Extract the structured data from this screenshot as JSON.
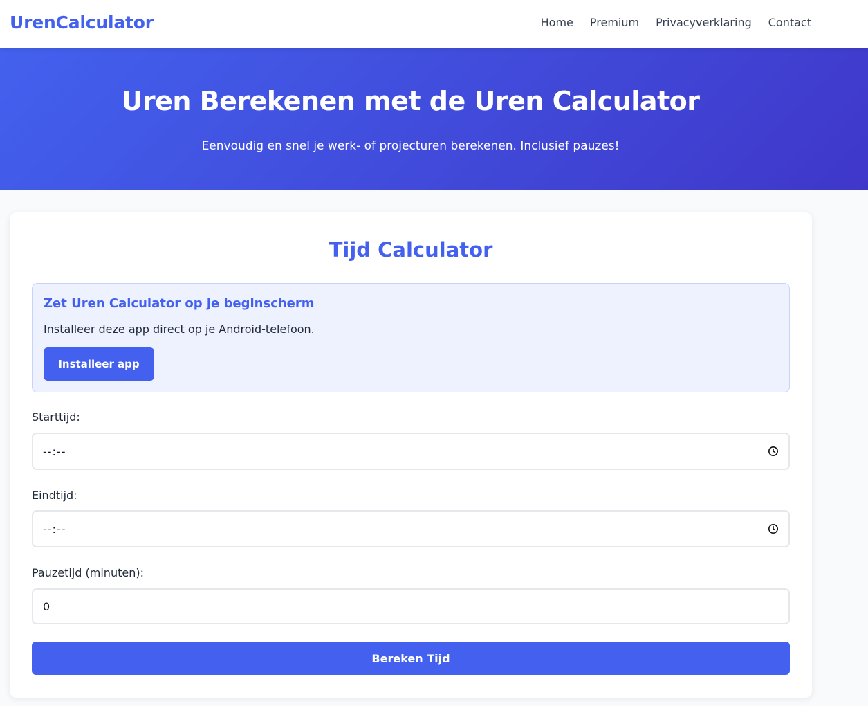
{
  "nav": {
    "brand": "UrenCalculator",
    "links": [
      "Home",
      "Premium",
      "Privacyverklaring",
      "Contact"
    ]
  },
  "hero": {
    "title": "Uren Berekenen met de Uren Calculator",
    "subtitle": "Eenvoudig en snel je werk- of projecturen berekenen. Inclusief pauzes!"
  },
  "calculator": {
    "title": "Tijd Calculator",
    "install": {
      "title": "Zet Uren Calculator op je beginscherm",
      "text": "Installeer deze app direct op je Android-telefoon.",
      "button": "Installeer app"
    },
    "fields": {
      "start": {
        "label": "Starttijd:",
        "value": "--:--",
        "icon": "clock-icon"
      },
      "end": {
        "label": "Eindtijd:",
        "value": "--:--",
        "icon": "clock-icon"
      },
      "pause": {
        "label": "Pauzetijd (minuten):",
        "value": "0"
      }
    },
    "submit": "Bereken Tijd"
  },
  "colors": {
    "accent": "#4361ee",
    "hero_gradient_start": "#4361ee",
    "hero_gradient_end": "#3f37c9",
    "install_bg": "#eef2ff"
  }
}
